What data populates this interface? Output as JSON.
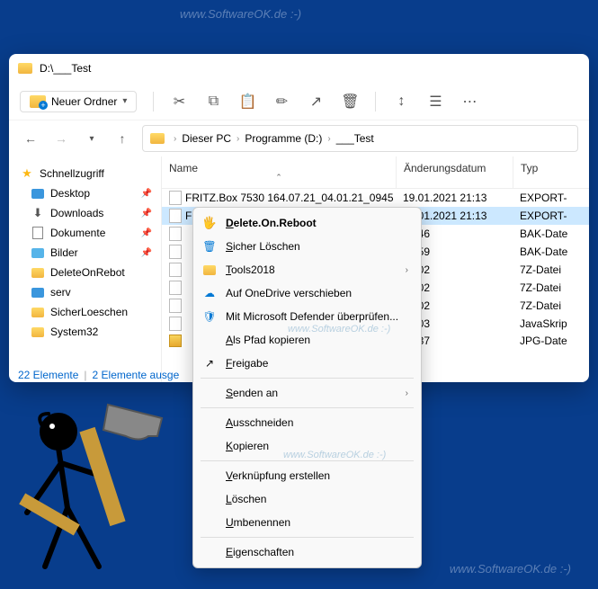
{
  "watermark": "www.SoftwareOK.de :-)",
  "window": {
    "title": "D:\\___Test"
  },
  "toolbar": {
    "new_label": "Neuer Ordner"
  },
  "breadcrumb": {
    "items": [
      "Dieser PC",
      "Programme (D:)",
      "___Test"
    ]
  },
  "sidebar": {
    "header": "Schnellzugriff",
    "items": [
      {
        "label": "Desktop",
        "pinned": true,
        "icon": "desktop"
      },
      {
        "label": "Downloads",
        "pinned": true,
        "icon": "downloads"
      },
      {
        "label": "Dokumente",
        "pinned": true,
        "icon": "documents"
      },
      {
        "label": "Bilder",
        "pinned": true,
        "icon": "pictures"
      },
      {
        "label": "DeleteOnRebot",
        "pinned": false,
        "icon": "folder"
      },
      {
        "label": "serv",
        "pinned": false,
        "icon": "serv"
      },
      {
        "label": "SicherLoeschen",
        "pinned": false,
        "icon": "folder"
      },
      {
        "label": "System32",
        "pinned": false,
        "icon": "folder"
      }
    ]
  },
  "columns": {
    "name": "Name",
    "date": "Änderungsdatum",
    "type": "Typ"
  },
  "rows": [
    {
      "name": "FRITZ.Box 7530 164.07.21_04.01.21_0945 (...",
      "date": "19.01.2021 21:13",
      "type": "EXPORT-",
      "selected": false
    },
    {
      "name": "FRITZ.Box 7530 164.07.21_04.01.21_0943 (",
      "date": "19.01.2021 21:13",
      "type": "EXPORT-",
      "selected": true
    },
    {
      "name": "",
      "date": "20:46",
      "type": "BAK-Date",
      "selected": false
    },
    {
      "name": "",
      "date": "18:59",
      "type": "BAK-Date",
      "selected": false
    },
    {
      "name": "",
      "date": "15:02",
      "type": "7Z-Datei",
      "selected": false
    },
    {
      "name": "",
      "date": "15:02",
      "type": "7Z-Datei",
      "selected": false
    },
    {
      "name": "",
      "date": "15:02",
      "type": "7Z-Datei",
      "selected": false
    },
    {
      "name": "",
      "date": "14:03",
      "type": "JavaSkrip",
      "selected": false
    },
    {
      "name": "",
      "date": "18:37",
      "type": "JPG-Date",
      "selected": false
    }
  ],
  "status": {
    "count": "22 Elemente",
    "selected": "2 Elemente ausge"
  },
  "context_menu": {
    "items": [
      {
        "label": "Delete.On.Reboot",
        "icon": "hand",
        "bold": true,
        "u": true
      },
      {
        "label": "Sicher Löschen",
        "icon": "trash-blue",
        "u": true
      },
      {
        "label": "Tools2018",
        "icon": "folder",
        "submenu": true,
        "u": true
      },
      {
        "label": "Auf OneDrive verschieben",
        "icon": "cloud"
      },
      {
        "label": "Mit Microsoft Defender überprüfen...",
        "icon": "shield"
      },
      {
        "label": "Als Pfad kopieren",
        "icon": "",
        "u": true
      },
      {
        "label": "Freigabe",
        "icon": "share",
        "u": true
      },
      {
        "sep": true
      },
      {
        "label": "Senden an",
        "icon": "",
        "submenu": true,
        "u": true
      },
      {
        "sep": true
      },
      {
        "label": "Ausschneiden",
        "icon": "",
        "u": true
      },
      {
        "label": "Kopieren",
        "icon": "",
        "u": true
      },
      {
        "sep": true
      },
      {
        "label": "Verknüpfung erstellen",
        "icon": "",
        "u": true
      },
      {
        "label": "Löschen",
        "icon": "",
        "u": true
      },
      {
        "label": "Umbenennen",
        "icon": "",
        "u": true
      },
      {
        "sep": true
      },
      {
        "label": "Eigenschaften",
        "icon": "",
        "u": true
      }
    ]
  }
}
